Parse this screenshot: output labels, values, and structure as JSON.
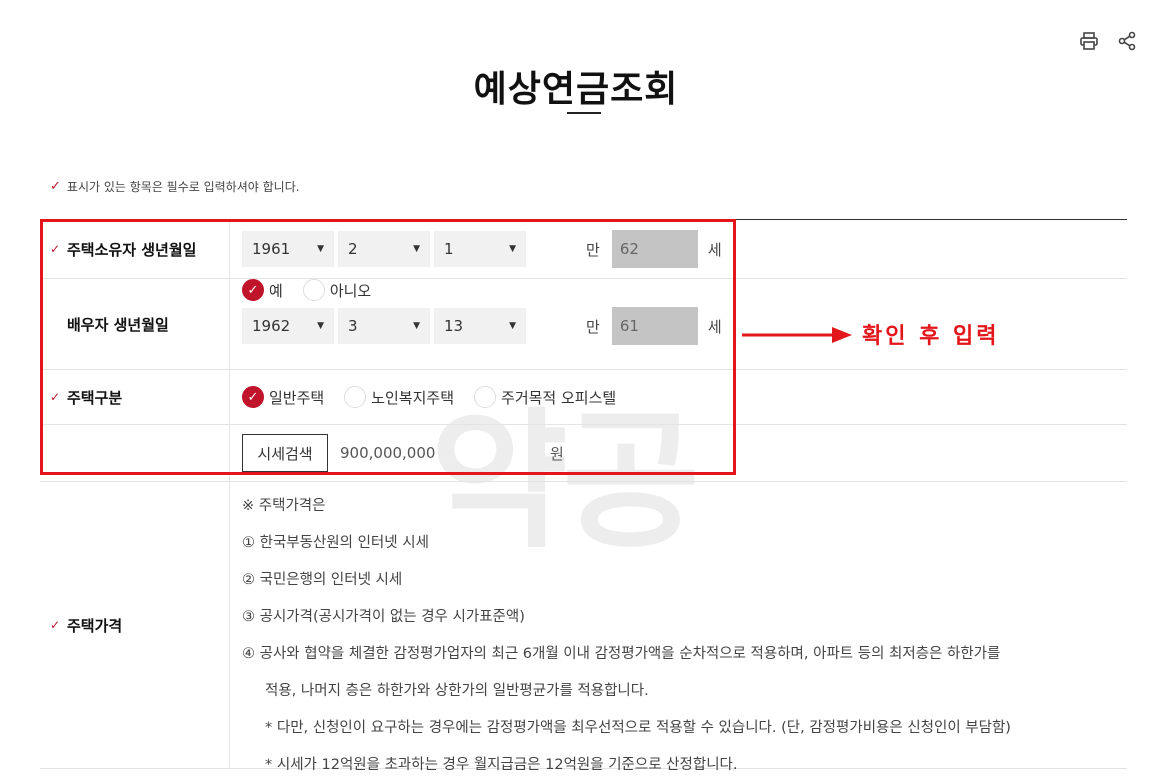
{
  "page": {
    "title": "예상연금조회",
    "notice": "표시가 있는 항목은 필수로 입력하셔야 합니다."
  },
  "colors": {
    "accent": "#c0142a",
    "annotation": "#e3161b"
  },
  "icons": {
    "print": "printer-icon",
    "share": "share-icon",
    "required": "check-icon"
  },
  "form": {
    "owner_birth": {
      "label": "주택소유자 생년월일",
      "year": "1961",
      "month": "2",
      "day": "1",
      "age_prefix": "만",
      "age": "62",
      "age_unit": "세"
    },
    "spouse_birth": {
      "label": "배우자 생년월일",
      "option_yes": "예",
      "option_no": "아니오",
      "selected": "예",
      "year": "1962",
      "month": "3",
      "day": "13",
      "age_prefix": "만",
      "age": "61",
      "age_unit": "세"
    },
    "house_type": {
      "label": "주택구분",
      "options": [
        "일반주택",
        "노인복지주택",
        "주거목적 오피스텔"
      ],
      "selected": "일반주택"
    },
    "house_price": {
      "label": "주택가격",
      "search_button": "시세검색",
      "value": "900,000,000",
      "unit": "원",
      "info": [
        "※ 주택가격은",
        "① 한국부동산원의 인터넷 시세",
        "② 국민은행의 인터넷 시세",
        "③ 공시가격(공시가격이 없는 경우 시가표준액)",
        "④ 공사와 협약을 체결한 감정평가업자의 최근 6개월 이내 감정평가액을 순차적으로 적용하며, 아파트 등의 최저층은 하한가를",
        "적용, 나머지 층은 하한가와 상한가의 일반평균가를 적용합니다.",
        "* 다만, 신청인이 요구하는 경우에는 감정평가액을 최우선적으로 적용할 수 있습니다. (단, 감정평가비용은 신청인이 부담함)",
        "* 시세가 12억원을 초과하는 경우 월지급금은 12억원을 기준으로 산정합니다."
      ]
    }
  },
  "annotation": {
    "text": "확인 후 입력"
  },
  "watermark": {
    "text": "약공"
  }
}
